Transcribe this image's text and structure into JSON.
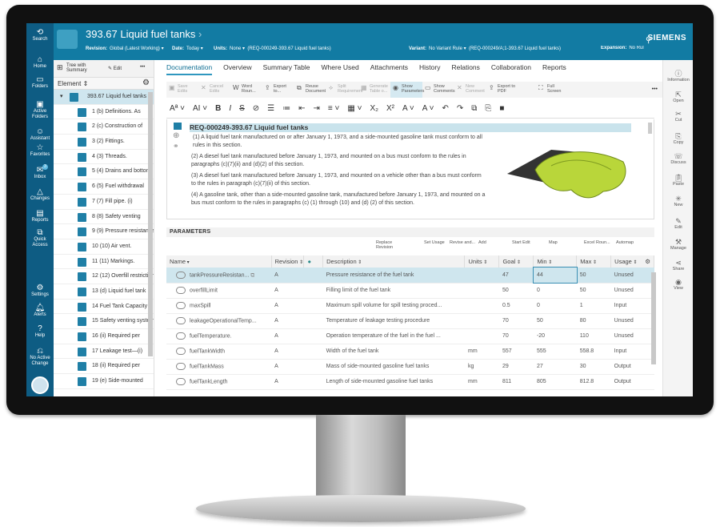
{
  "header": {
    "title": "393.67   Liquid fuel tanks",
    "revision_label": "Revision:",
    "revision_value": "Global (Latest Working)",
    "date_label": "Date:",
    "date_value": "Today",
    "units_label": "Units:",
    "units_value": "None",
    "context1": "(REQ-000249-393.67  Liquid fuel tanks)",
    "variant_label": "Variant:",
    "variant_value": "No Variant Rule",
    "context2": "(REQ-000249/A;1-393.67  Liquid fuel tanks)",
    "expansion_label": "Expansion:",
    "expansion_value": "No Rul",
    "brand": "SIEMENS"
  },
  "nav": [
    {
      "label": "Search",
      "icon": "search-icon"
    },
    {
      "label": "Home",
      "icon": "home-icon"
    },
    {
      "label": "Folders",
      "icon": "folder-icon"
    },
    {
      "label": "Active Folders",
      "icon": "active-folder-icon"
    },
    {
      "label": "Assistant",
      "icon": "assistant-icon"
    },
    {
      "label": "Favorites",
      "icon": "star-icon"
    },
    {
      "label": "Inbox",
      "icon": "inbox-icon",
      "badge": "3"
    },
    {
      "label": "Changes",
      "icon": "triangle-icon"
    },
    {
      "label": "Reports",
      "icon": "report-icon"
    },
    {
      "label": "Quick Access",
      "icon": "quick-access-icon"
    },
    {
      "label": "Settings",
      "icon": "gear-icon"
    },
    {
      "label": "Alerts",
      "icon": "bell-icon"
    },
    {
      "label": "Help",
      "icon": "help-icon"
    },
    {
      "label": "No Active Change",
      "icon": "change-icon"
    }
  ],
  "tree": {
    "view_label": "Tree with Summary",
    "edit_label": "Edit",
    "more": "•••",
    "column": "Element",
    "items": [
      "393.67   Liquid fuel tanks",
      "1 (b) Definitions. As",
      "2 (c) Construction of",
      "3 (2) Fittings.",
      "4 (3) Threads.",
      "5 (4) Drains and bottom",
      "6 (5) Fuel withdrawal",
      "7 (7) Fill pipe. (i)",
      "8 (8) Safety venting",
      "9 (9) Pressure resistance",
      "10 (10) Air vent.",
      "11 (11) Markings.",
      "12 (12) Overfill restriction",
      "13 (d) Liquid fuel tank",
      "14 Fuel Tank Capacity",
      "15 Safety venting system",
      "16 (ii) Required per",
      "17 Leakage test—(i)",
      "18 (ii) Required per",
      "19 (e) Side-mounted"
    ]
  },
  "tabs": [
    "Documentation",
    "Overview",
    "Summary Table",
    "Where Used",
    "Attachments",
    "History",
    "Relations",
    "Collaboration",
    "Reports"
  ],
  "toolbar": [
    {
      "label": "Save Edits",
      "icon": "save-icon",
      "state": "disabled"
    },
    {
      "label": "Cancel Edits",
      "icon": "cancel-icon",
      "state": "disabled"
    },
    {
      "label": "Word Roun...",
      "icon": "word-icon"
    },
    {
      "label": "Export to...",
      "icon": "export-icon"
    },
    {
      "label": "Reuse Document",
      "icon": "reuse-icon"
    },
    {
      "label": "Split Requirement",
      "icon": "split-icon",
      "state": "disabled"
    },
    {
      "label": "Generate Table o...",
      "icon": "table-icon",
      "state": "disabled"
    },
    {
      "label": "Show Parameters",
      "icon": "eye-icon",
      "state": "active"
    },
    {
      "label": "Show Comments",
      "icon": "comment-icon"
    },
    {
      "label": "New Comment",
      "icon": "new-comment-icon",
      "state": "disabled"
    },
    {
      "label": "Export to PDF",
      "icon": "pdf-icon"
    },
    {
      "label": "Full Screen",
      "icon": "fullscreen-icon"
    }
  ],
  "format_toolbar": [
    "Aª ˅",
    "AI ˅",
    "B",
    "I",
    "S",
    "⊘",
    "☰",
    "≔",
    "⇤",
    "⇥",
    "≡ ˅",
    "▦ ˅",
    "X₂",
    "X²",
    "A ˅",
    "A ˅",
    "↶",
    "↷",
    "⧉",
    "⎘",
    "■"
  ],
  "document": {
    "title": "REQ-000249-393.67   Liquid fuel tanks",
    "paragraphs": [
      "(1) A liquid fuel tank manufactured on or after January 1, 1973, and a side-mounted gasoline tank must conform to all rules in this section.",
      "(2) A diesel fuel tank manufactured before January 1, 1973, and mounted on a bus must conform to the rules in paragraphs (c)(7)(ii) and (d)(2) of this section.",
      "(3) A diesel fuel tank manufactured before January 1, 1973, and mounted on a vehicle other than a bus must conform to the rules in paragraph (c)(7)(ii) of this section.",
      "(4) A gasoline tank, other than a side-mounted gasoline tank, manufactured before January 1, 1973, and mounted on a bus must conform to the rules in paragraphs (c) (1) through (10) and (d) (2) of this section."
    ]
  },
  "parameters": {
    "title": "PARAMETERS",
    "toolbar": [
      "Replace Revision",
      "Set Usage",
      "Revise and...",
      "Add",
      "Start Edit",
      "Map",
      "Excel Roun...",
      "Automap"
    ],
    "columns": [
      "Name",
      "Revision",
      "",
      "Description",
      "Units",
      "Goal",
      "Min",
      "Max",
      "Usage"
    ],
    "rows": [
      [
        "tankPressureResistan...",
        "A",
        "Pressure resistance of the fuel tank",
        "",
        "47",
        "44",
        "50",
        "Unused"
      ],
      [
        "overfillLimit",
        "A",
        "Filling limit of the fuel tank",
        "",
        "50",
        "0",
        "50",
        "Unused"
      ],
      [
        "maxSpill",
        "A",
        "Maximum spill volume for spill testing proced...",
        "",
        "0.5",
        "0",
        "1",
        "Input"
      ],
      [
        "leakageOperationalTemp...",
        "A",
        "Temperature of leakage testing procedure",
        "",
        "70",
        "50",
        "80",
        "Unused"
      ],
      [
        "fuelTemperature.",
        "A",
        "Operation temperature of the fuel in the fuel ...",
        "",
        "70",
        "-20",
        "110",
        "Unused"
      ],
      [
        "fuelTankWidth",
        "A",
        "Width of the fuel tank",
        "mm",
        "557",
        "555",
        "558.8",
        "Input"
      ],
      [
        "fuelTankMass",
        "A",
        "Mass of side-mounted gasoline fuel tanks",
        "kg",
        "29",
        "27",
        "30",
        "Output"
      ],
      [
        "fuelTankLength",
        "A",
        "Length of side-mounted gasoline fuel tanks",
        "mm",
        "811",
        "805",
        "812.8",
        "Output"
      ]
    ]
  },
  "right_sidebar": [
    {
      "label": "Information",
      "icon": "info-icon"
    },
    {
      "label": "Open",
      "icon": "open-icon"
    },
    {
      "label": "Cut",
      "icon": "cut-icon"
    },
    {
      "label": "Copy",
      "icon": "copy-icon"
    },
    {
      "label": "Discuss",
      "icon": "discuss-icon"
    },
    {
      "label": "Paste",
      "icon": "paste-icon"
    },
    {
      "label": "New",
      "icon": "new-icon"
    },
    {
      "label": "Edit",
      "icon": "pencil-icon"
    },
    {
      "label": "Manage",
      "icon": "manage-icon"
    },
    {
      "label": "Share",
      "icon": "share-icon"
    },
    {
      "label": "View",
      "icon": "eye-icon"
    }
  ],
  "colors": {
    "header": "#127ba3",
    "nav": "#0e5c83",
    "selection": "#cfe6ef"
  }
}
